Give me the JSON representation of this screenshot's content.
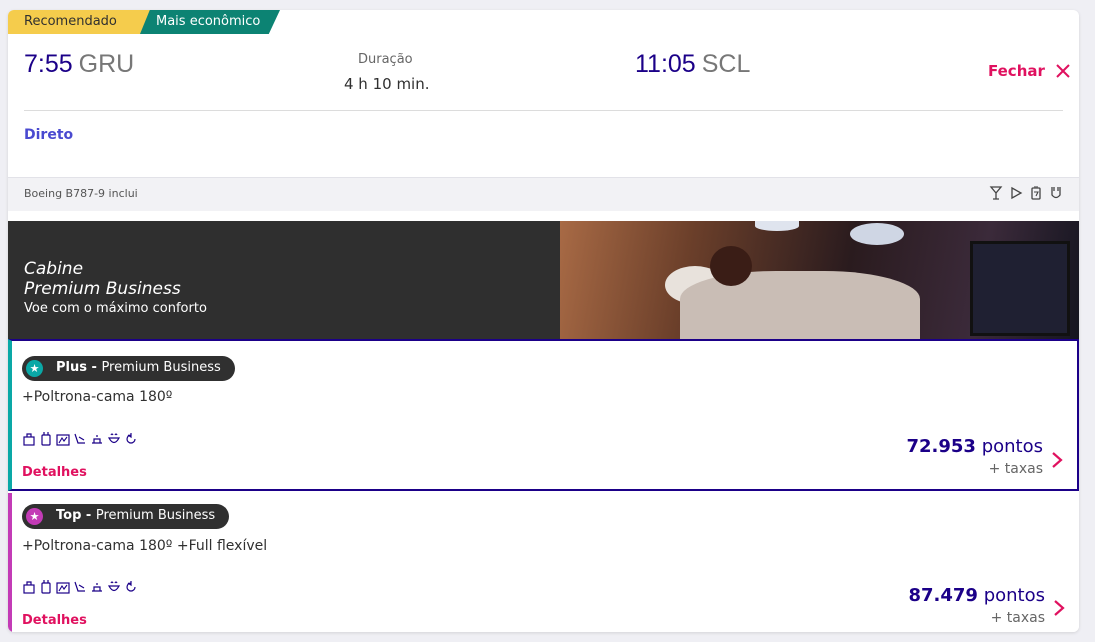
{
  "tags": {
    "recommended": "Recomendado",
    "cheapest": "Mais econômico"
  },
  "flight": {
    "departure_time": "7:55",
    "departure_code": "GRU",
    "duration_label": "Duração",
    "duration_value": "4 h 10 min.",
    "arrival_time": "11:05",
    "arrival_code": "SCL",
    "close_label": "Fechar",
    "stops": "Direto"
  },
  "aircraft": {
    "text": "Boeing B787-9 inclui",
    "amenities": [
      "cocktail-icon",
      "play-icon",
      "power-icon",
      "usb-icon"
    ]
  },
  "cabin": {
    "prefix": "Cabine",
    "name": "Premium Business",
    "tagline": "Voe com o máximo conforto"
  },
  "fares": [
    {
      "tier": "Plus",
      "separator": " - ",
      "cabin": "Premium Business",
      "features": "+Poltrona-cama 180º",
      "details_label": "Detalhes",
      "price": "72.953",
      "currency": "pontos",
      "taxes": "+ taxas",
      "accent": "#0aa8a6"
    },
    {
      "tier": "Top",
      "separator": " - ",
      "cabin": "Premium Business",
      "features": "+Poltrona-cama 180º +Full flexível",
      "details_label": "Detalhes",
      "price": "87.479",
      "currency": "pontos",
      "taxes": "+ taxas",
      "accent": "#c33bb6"
    }
  ],
  "fare_icons": [
    "carry-on-icon",
    "checked-bag-icon",
    "seat-selection-icon",
    "flat-bed-icon",
    "lounge-icon",
    "food-icon",
    "change-icon"
  ],
  "colors": {
    "brand": "#1b0088",
    "accent": "#e0115f",
    "link": "#4a4ad0"
  }
}
